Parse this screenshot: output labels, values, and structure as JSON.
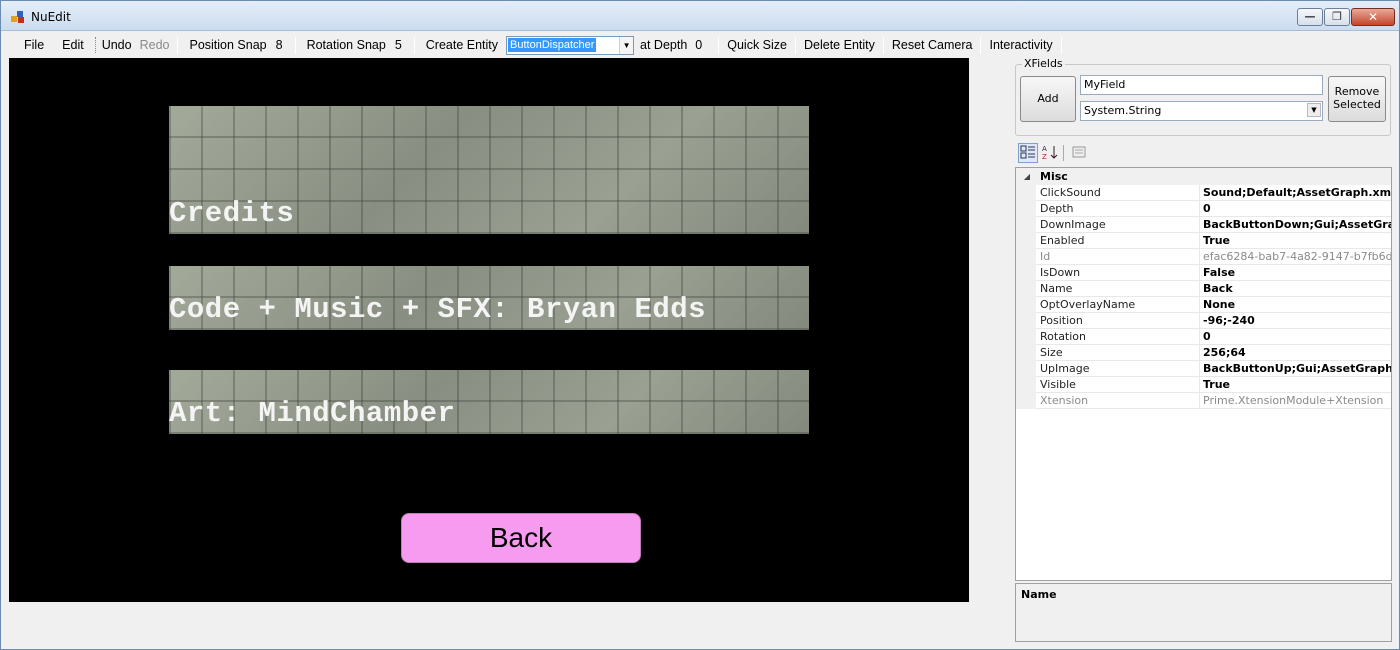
{
  "window": {
    "title": "NuEdit"
  },
  "menubar": {
    "file": "File",
    "edit": "Edit",
    "undo": "Undo",
    "redo": "Redo",
    "position_snap_label": "Position Snap",
    "position_snap_value": "8",
    "rotation_snap_label": "Rotation Snap",
    "rotation_snap_value": "5",
    "create_entity": "Create Entity",
    "entity_type": "ButtonDispatcher",
    "at_depth_label": "at Depth",
    "at_depth_value": "0",
    "quick_size": "Quick Size",
    "delete_entity": "Delete Entity",
    "reset_camera": "Reset Camera",
    "interactivity": "Interactivity"
  },
  "viewport": {
    "labels": [
      "Credits",
      "Code + Music + SFX: Bryan Edds",
      "Art: MindChamber"
    ],
    "back_button": "Back"
  },
  "xfields": {
    "legend": "XFields",
    "add": "Add",
    "field_name": "MyField",
    "field_type": "System.String",
    "remove_selected": [
      "Remove",
      "Selected"
    ]
  },
  "property_grid": {
    "category": "Misc",
    "rows": [
      {
        "name": "ClickSound",
        "value": "Sound;Default;AssetGraph.xml"
      },
      {
        "name": "Depth",
        "value": "0"
      },
      {
        "name": "DownImage",
        "value": "BackButtonDown;Gui;AssetGraph.xml"
      },
      {
        "name": "Enabled",
        "value": "True"
      },
      {
        "name": "Id",
        "value": "efac6284-bab7-4a82-9147-b7fb6d"
      },
      {
        "name": "IsDown",
        "value": "False"
      },
      {
        "name": "Name",
        "value": "Back"
      },
      {
        "name": "OptOverlayName",
        "value": "None"
      },
      {
        "name": "Position",
        "value": "-96;-240"
      },
      {
        "name": "Rotation",
        "value": "0"
      },
      {
        "name": "Size",
        "value": "256;64"
      },
      {
        "name": "UpImage",
        "value": "BackButtonUp;Gui;AssetGraph.xml"
      },
      {
        "name": "Visible",
        "value": "True"
      },
      {
        "name": "Xtension",
        "value": "Prime.XtensionModule+Xtension"
      }
    ]
  },
  "help_panel": {
    "name": "Name"
  }
}
